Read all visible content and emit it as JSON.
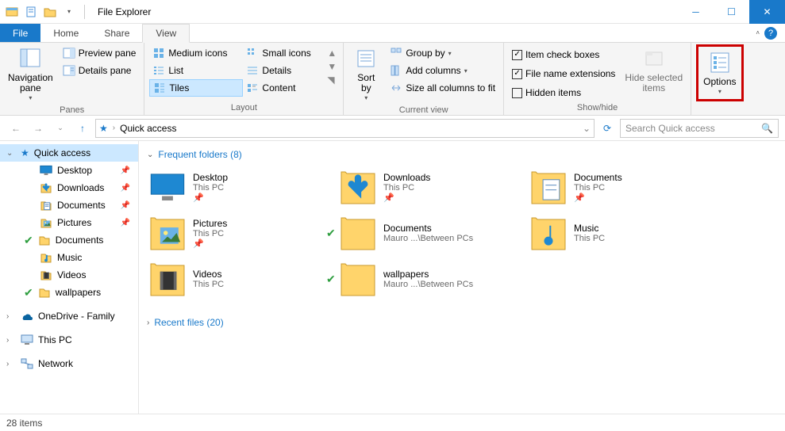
{
  "window": {
    "title": "File Explorer"
  },
  "tabs": {
    "file": "File",
    "home": "Home",
    "share": "Share",
    "view": "View"
  },
  "ribbon": {
    "panes": {
      "navigation": "Navigation\npane",
      "preview": "Preview pane",
      "details": "Details pane",
      "group": "Panes"
    },
    "layout": {
      "medium": "Medium icons",
      "small": "Small icons",
      "list": "List",
      "details": "Details",
      "tiles": "Tiles",
      "content": "Content",
      "group": "Layout"
    },
    "currentview": {
      "sortby": "Sort\nby",
      "groupby": "Group by",
      "addcols": "Add columns",
      "sizeall": "Size all columns to fit",
      "group": "Current view"
    },
    "showhide": {
      "itemcheck": "Item check boxes",
      "fileext": "File name extensions",
      "hidden": "Hidden items",
      "hidesel": "Hide selected\nitems",
      "group": "Show/hide"
    },
    "options": "Options"
  },
  "address": {
    "location": "Quick access",
    "search_placeholder": "Search Quick access"
  },
  "sidebar": {
    "quickaccess": "Quick access",
    "items": [
      {
        "label": "Desktop",
        "pinned": true,
        "icon": "desktop"
      },
      {
        "label": "Downloads",
        "pinned": true,
        "icon": "downloads"
      },
      {
        "label": "Documents",
        "pinned": true,
        "icon": "documents"
      },
      {
        "label": "Pictures",
        "pinned": true,
        "icon": "pictures"
      },
      {
        "label": "Documents",
        "pinned": false,
        "icon": "folder",
        "sync": true
      },
      {
        "label": "Music",
        "pinned": false,
        "icon": "music"
      },
      {
        "label": "Videos",
        "pinned": false,
        "icon": "videos"
      },
      {
        "label": "wallpapers",
        "pinned": false,
        "icon": "folder",
        "sync": true
      }
    ],
    "onedrive": "OneDrive - Family",
    "thispc": "This PC",
    "network": "Network"
  },
  "content": {
    "frequent_header": "Frequent folders (8)",
    "recent_header": "Recent files (20)",
    "folders": [
      {
        "name": "Desktop",
        "sub": "This PC",
        "icon": "desktop",
        "pinned": true
      },
      {
        "name": "Downloads",
        "sub": "This PC",
        "icon": "downloads",
        "pinned": true
      },
      {
        "name": "Documents",
        "sub": "This PC",
        "icon": "documents",
        "pinned": true
      },
      {
        "name": "Pictures",
        "sub": "This PC",
        "icon": "pictures",
        "pinned": true
      },
      {
        "name": "Documents",
        "sub": "Mauro ...\\Between PCs",
        "icon": "folder",
        "sync": true
      },
      {
        "name": "Music",
        "sub": "This PC",
        "icon": "music"
      },
      {
        "name": "Videos",
        "sub": "This PC",
        "icon": "videos"
      },
      {
        "name": "wallpapers",
        "sub": "Mauro ...\\Between PCs",
        "icon": "folder",
        "sync": true
      }
    ]
  },
  "status": {
    "text": "28 items"
  }
}
